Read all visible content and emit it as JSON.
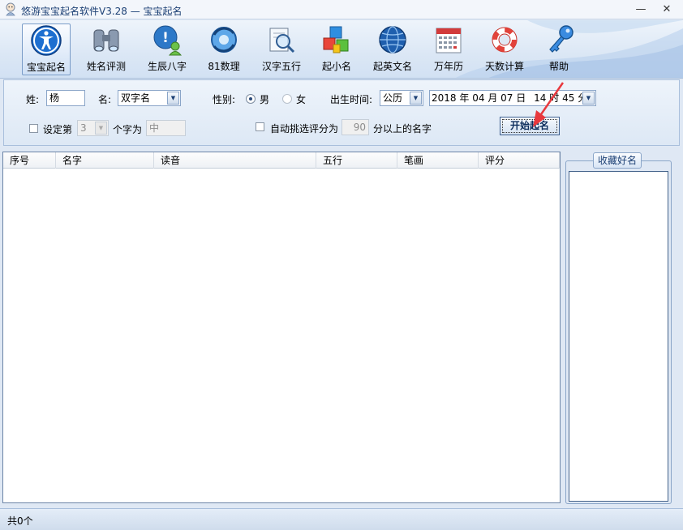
{
  "window": {
    "title": "悠游宝宝起名软件V3.28  —  宝宝起名",
    "minimize": "—",
    "close": "✕"
  },
  "toolbar": {
    "items": [
      {
        "label": "宝宝起名",
        "icon": "person-icon",
        "active": true
      },
      {
        "label": "姓名评测",
        "icon": "binoculars-icon"
      },
      {
        "label": "生辰八字",
        "icon": "help-person-icon"
      },
      {
        "label": "81数理",
        "icon": "refresh-globe-icon"
      },
      {
        "label": "汉字五行",
        "icon": "magnifier-icon"
      },
      {
        "label": "起小名",
        "icon": "cubes-icon"
      },
      {
        "label": "起英文名",
        "icon": "globe-icon"
      },
      {
        "label": "万年历",
        "icon": "calendar-icon"
      },
      {
        "label": "天数计算",
        "icon": "lifebuoy-icon"
      },
      {
        "label": "帮助",
        "icon": "key-icon"
      }
    ]
  },
  "form": {
    "surname_label": "姓:",
    "surname_value": "杨",
    "name_label": "名:",
    "name_type": "双字名",
    "gender_label": "性别:",
    "gender_male": "男",
    "gender_female": "女",
    "gender_selected": "男",
    "birth_label": "出生时间:",
    "calendar_type": "公历",
    "birth_year": "2018",
    "year_unit": "年",
    "birth_month": "04",
    "month_unit": "月",
    "birth_day": "07",
    "day_unit": "日",
    "birth_hour": "14",
    "hour_unit": "时",
    "birth_minute": "45",
    "minute_unit": "分",
    "set_char_label": "设定第",
    "set_char_index": "3",
    "char_is_label": "个字为",
    "char_value": "中",
    "auto_pick_label": "自动挑选评分为",
    "auto_pick_score": "90",
    "auto_pick_suffix": "分以上的名字",
    "start_button": "开始起名"
  },
  "results": {
    "columns": [
      "序号",
      "名字",
      "读音",
      "五行",
      "笔画",
      "评分"
    ],
    "rows": []
  },
  "favorites": {
    "title": "收藏好名"
  },
  "status": {
    "count_text": "共0个"
  },
  "colors": {
    "accent": "#1b3f74",
    "panel": "#dde8f5",
    "arrow": "#e8383d"
  }
}
